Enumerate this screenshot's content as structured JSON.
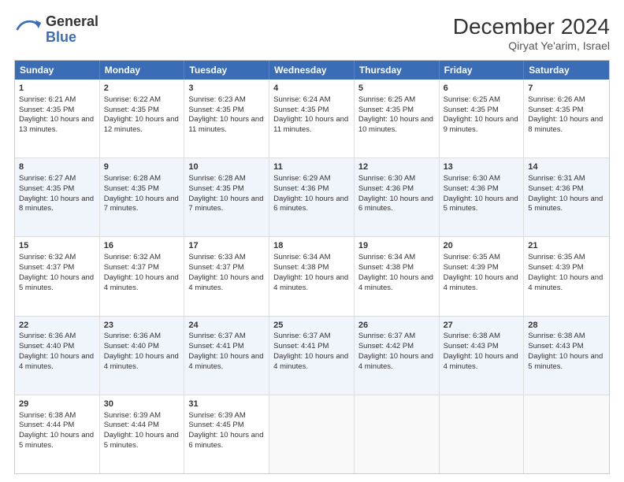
{
  "header": {
    "logo_line1": "General",
    "logo_line2": "Blue",
    "title": "December 2024",
    "subtitle": "Qiryat Ye'arim, Israel"
  },
  "weekdays": [
    "Sunday",
    "Monday",
    "Tuesday",
    "Wednesday",
    "Thursday",
    "Friday",
    "Saturday"
  ],
  "rows": [
    [
      {
        "day": "1",
        "sunrise": "6:21 AM",
        "sunset": "4:35 PM",
        "daylight": "10 hours and 13 minutes."
      },
      {
        "day": "2",
        "sunrise": "6:22 AM",
        "sunset": "4:35 PM",
        "daylight": "10 hours and 12 minutes."
      },
      {
        "day": "3",
        "sunrise": "6:23 AM",
        "sunset": "4:35 PM",
        "daylight": "10 hours and 11 minutes."
      },
      {
        "day": "4",
        "sunrise": "6:24 AM",
        "sunset": "4:35 PM",
        "daylight": "10 hours and 11 minutes."
      },
      {
        "day": "5",
        "sunrise": "6:25 AM",
        "sunset": "4:35 PM",
        "daylight": "10 hours and 10 minutes."
      },
      {
        "day": "6",
        "sunrise": "6:25 AM",
        "sunset": "4:35 PM",
        "daylight": "10 hours and 9 minutes."
      },
      {
        "day": "7",
        "sunrise": "6:26 AM",
        "sunset": "4:35 PM",
        "daylight": "10 hours and 8 minutes."
      }
    ],
    [
      {
        "day": "8",
        "sunrise": "6:27 AM",
        "sunset": "4:35 PM",
        "daylight": "10 hours and 8 minutes."
      },
      {
        "day": "9",
        "sunrise": "6:28 AM",
        "sunset": "4:35 PM",
        "daylight": "10 hours and 7 minutes."
      },
      {
        "day": "10",
        "sunrise": "6:28 AM",
        "sunset": "4:35 PM",
        "daylight": "10 hours and 7 minutes."
      },
      {
        "day": "11",
        "sunrise": "6:29 AM",
        "sunset": "4:36 PM",
        "daylight": "10 hours and 6 minutes."
      },
      {
        "day": "12",
        "sunrise": "6:30 AM",
        "sunset": "4:36 PM",
        "daylight": "10 hours and 6 minutes."
      },
      {
        "day": "13",
        "sunrise": "6:30 AM",
        "sunset": "4:36 PM",
        "daylight": "10 hours and 5 minutes."
      },
      {
        "day": "14",
        "sunrise": "6:31 AM",
        "sunset": "4:36 PM",
        "daylight": "10 hours and 5 minutes."
      }
    ],
    [
      {
        "day": "15",
        "sunrise": "6:32 AM",
        "sunset": "4:37 PM",
        "daylight": "10 hours and 5 minutes."
      },
      {
        "day": "16",
        "sunrise": "6:32 AM",
        "sunset": "4:37 PM",
        "daylight": "10 hours and 4 minutes."
      },
      {
        "day": "17",
        "sunrise": "6:33 AM",
        "sunset": "4:37 PM",
        "daylight": "10 hours and 4 minutes."
      },
      {
        "day": "18",
        "sunrise": "6:34 AM",
        "sunset": "4:38 PM",
        "daylight": "10 hours and 4 minutes."
      },
      {
        "day": "19",
        "sunrise": "6:34 AM",
        "sunset": "4:38 PM",
        "daylight": "10 hours and 4 minutes."
      },
      {
        "day": "20",
        "sunrise": "6:35 AM",
        "sunset": "4:39 PM",
        "daylight": "10 hours and 4 minutes."
      },
      {
        "day": "21",
        "sunrise": "6:35 AM",
        "sunset": "4:39 PM",
        "daylight": "10 hours and 4 minutes."
      }
    ],
    [
      {
        "day": "22",
        "sunrise": "6:36 AM",
        "sunset": "4:40 PM",
        "daylight": "10 hours and 4 minutes."
      },
      {
        "day": "23",
        "sunrise": "6:36 AM",
        "sunset": "4:40 PM",
        "daylight": "10 hours and 4 minutes."
      },
      {
        "day": "24",
        "sunrise": "6:37 AM",
        "sunset": "4:41 PM",
        "daylight": "10 hours and 4 minutes."
      },
      {
        "day": "25",
        "sunrise": "6:37 AM",
        "sunset": "4:41 PM",
        "daylight": "10 hours and 4 minutes."
      },
      {
        "day": "26",
        "sunrise": "6:37 AM",
        "sunset": "4:42 PM",
        "daylight": "10 hours and 4 minutes."
      },
      {
        "day": "27",
        "sunrise": "6:38 AM",
        "sunset": "4:43 PM",
        "daylight": "10 hours and 4 minutes."
      },
      {
        "day": "28",
        "sunrise": "6:38 AM",
        "sunset": "4:43 PM",
        "daylight": "10 hours and 5 minutes."
      }
    ],
    [
      {
        "day": "29",
        "sunrise": "6:38 AM",
        "sunset": "4:44 PM",
        "daylight": "10 hours and 5 minutes."
      },
      {
        "day": "30",
        "sunrise": "6:39 AM",
        "sunset": "4:44 PM",
        "daylight": "10 hours and 5 minutes."
      },
      {
        "day": "31",
        "sunrise": "6:39 AM",
        "sunset": "4:45 PM",
        "daylight": "10 hours and 6 minutes."
      },
      null,
      null,
      null,
      null
    ]
  ]
}
